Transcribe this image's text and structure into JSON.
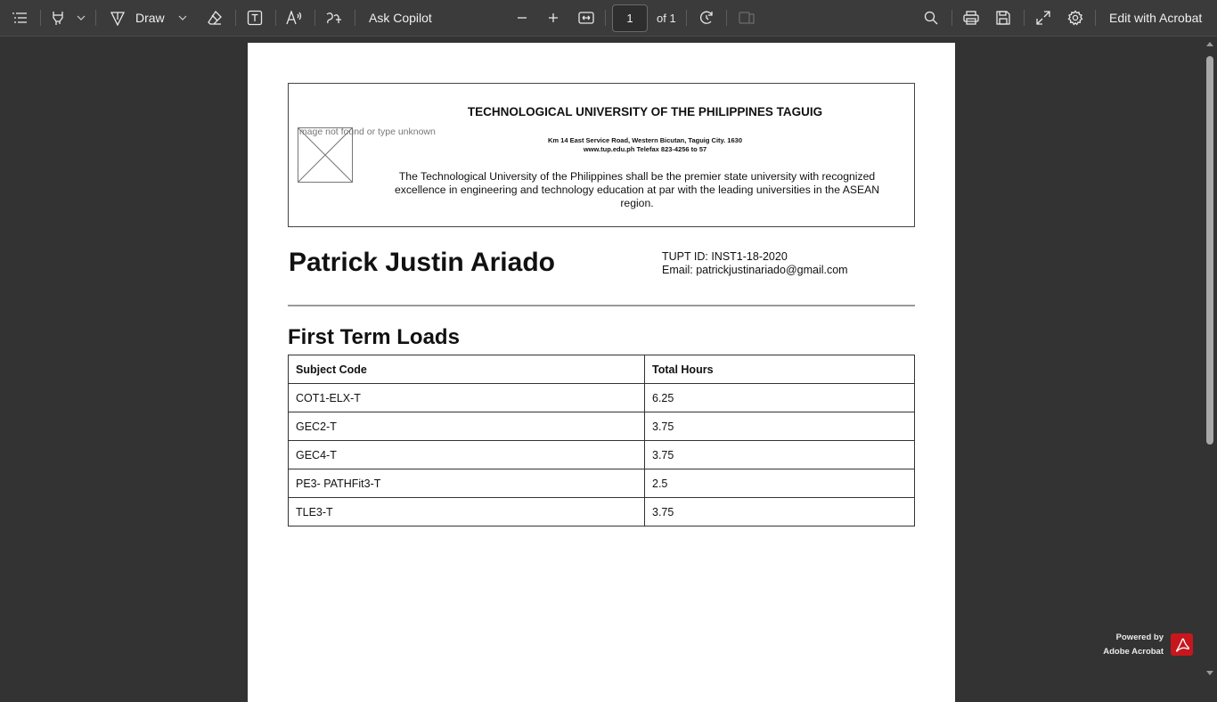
{
  "toolbar": {
    "draw_label": "Draw",
    "ask_copilot_label": "Ask Copilot",
    "page_current": "1",
    "page_total": "of 1",
    "edit_label": "Edit with Acrobat"
  },
  "document": {
    "header": {
      "image_placeholder": "Image not found or type unknown",
      "university_name": "TECHNOLOGICAL UNIVERSITY OF THE PHILIPPINES TAGUIG",
      "address_line1": "Km 14 East Service Road, Western Bicutan, Taguig City. 1630",
      "address_line2": "www.tup.edu.ph Telefax 823-4256 to 57",
      "vision": "The Technological University of the Philippines shall be the premier state university with recognized excellence in engineering and technology education at par with the leading universities in the ASEAN region."
    },
    "person": {
      "name": "Patrick Justin Ariado",
      "tupt_id": "TUPT ID: INST1-18-2020",
      "email": "Email: patrickjustinariado@gmail.com"
    },
    "section_title": "First Term Loads",
    "table": {
      "headers": [
        "Subject Code",
        "Total Hours"
      ],
      "rows": [
        [
          "COT1-ELX-T",
          "6.25"
        ],
        [
          "GEC2-T",
          "3.75"
        ],
        [
          "GEC4-T",
          "3.75"
        ],
        [
          "PE3- PATHFit3-T",
          "2.5"
        ],
        [
          "TLE3-T",
          "3.75"
        ]
      ]
    }
  },
  "footer": {
    "powered_by": "Powered by",
    "brand": "Adobe Acrobat"
  },
  "colors": {
    "toolbar_bg": "#3b3b3b",
    "viewer_bg": "#333333",
    "acrobat_red": "#c8161d"
  }
}
